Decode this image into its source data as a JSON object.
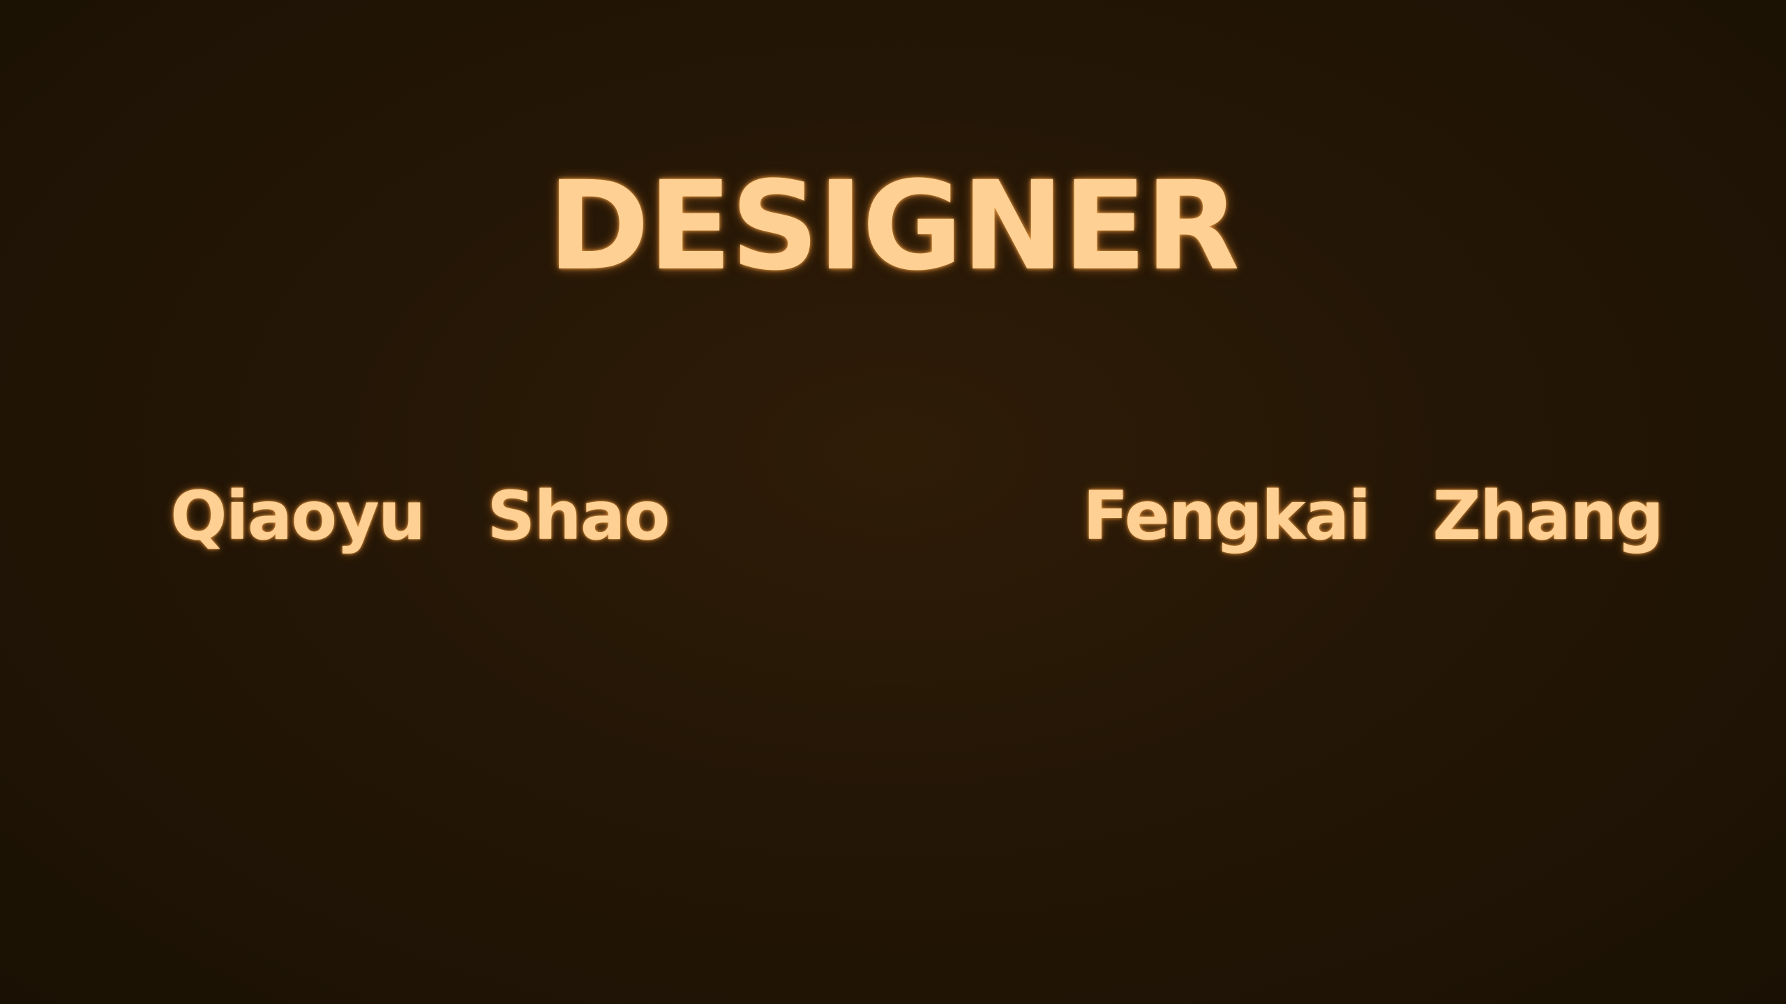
{
  "credits_screen": {
    "heading": "DESIGNER",
    "designers": [
      {
        "first_name": "Qiaoyu",
        "last_name": "Shao"
      },
      {
        "first_name": "Fengkai",
        "last_name": "Zhang"
      }
    ]
  },
  "colors": {
    "text": "#ffd093",
    "glow": "#ffaa46",
    "background": "#241606"
  }
}
